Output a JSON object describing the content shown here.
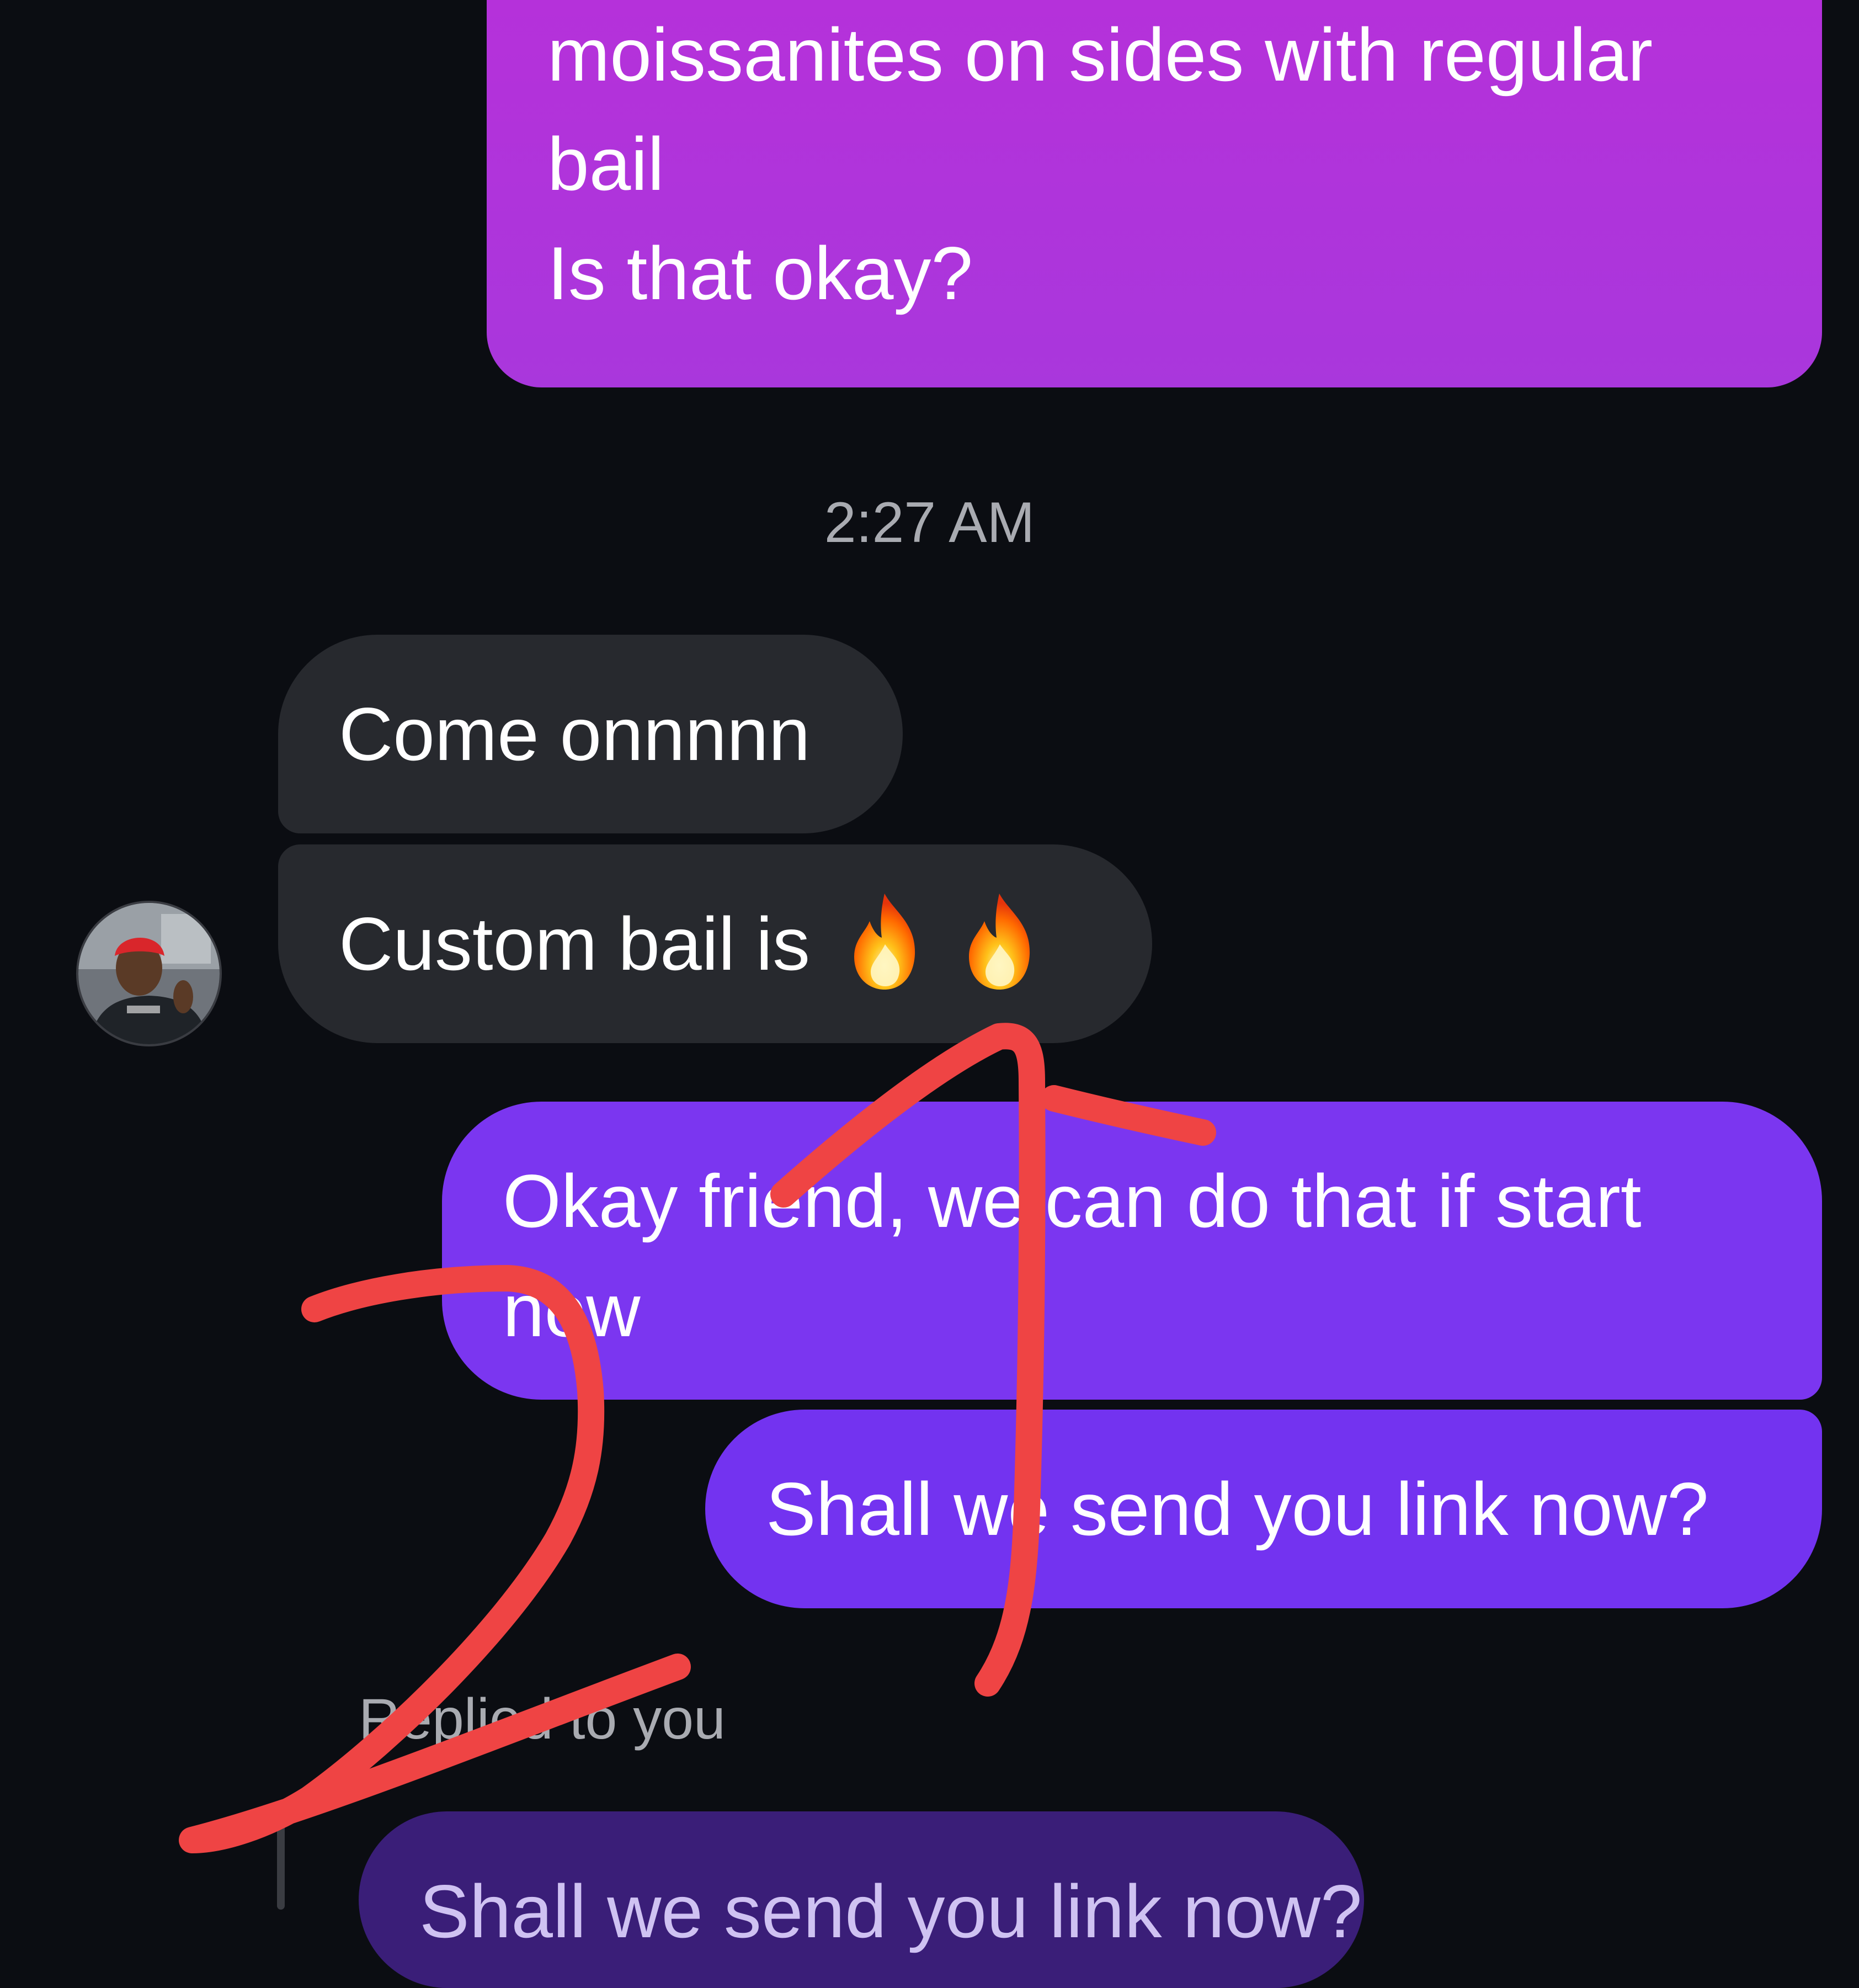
{
  "messages": {
    "top": {
      "line1": "moissanites on sides with regular",
      "line2": "bail",
      "line3": "Is that okay?"
    },
    "come": {
      "text": "Come onnnnn"
    },
    "custom": {
      "text": "Custom bail is",
      "emoji": "fire-icon fire-icon"
    },
    "okay": {
      "text": "Okay friend, we can do that if start now"
    },
    "shall": {
      "text": "Shall we send you link now?"
    }
  },
  "timestamp": "2:27 AM",
  "reply": {
    "label": "Replied to you",
    "preview_text": "Shall we send you link now?"
  },
  "colors": {
    "background": "#0b0d12",
    "incoming_bubble": "#27292e",
    "outgoing_bubble": "#7b36f0",
    "top_bubble": "#b033da",
    "reply_preview": "#3a1e78",
    "annotation": "#ef4444"
  }
}
